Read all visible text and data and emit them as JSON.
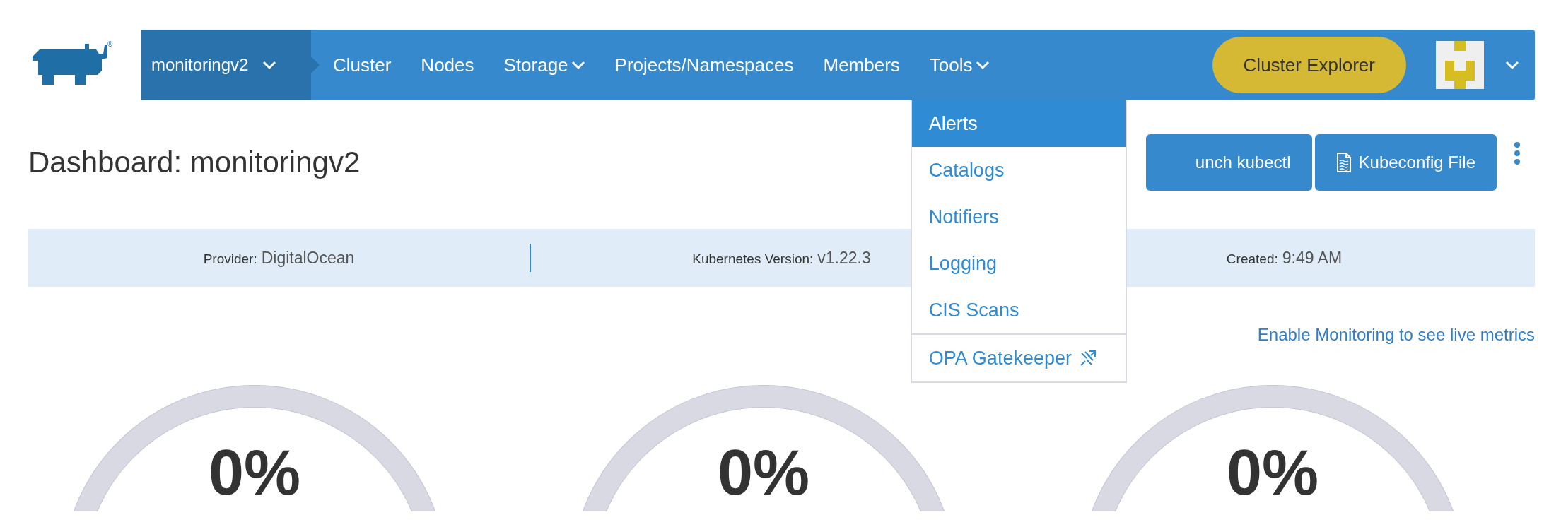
{
  "logo": {
    "mark": "®"
  },
  "nav": {
    "cluster": {
      "label": "monitoringv2"
    },
    "items": [
      {
        "label": "Cluster",
        "has_menu": false
      },
      {
        "label": "Nodes",
        "has_menu": false
      },
      {
        "label": "Storage",
        "has_menu": true
      },
      {
        "label": "Projects/Namespaces",
        "has_menu": false
      },
      {
        "label": "Members",
        "has_menu": false
      },
      {
        "label": "Tools",
        "has_menu": true,
        "expanded": true,
        "menu": [
          {
            "label": "Alerts",
            "selected": true,
            "external": false
          },
          {
            "label": "Catalogs",
            "selected": false,
            "external": false
          },
          {
            "label": "Notifiers",
            "selected": false,
            "external": false
          },
          {
            "label": "Logging",
            "selected": false,
            "external": false
          },
          {
            "label": "CIS Scans",
            "selected": false,
            "external": false
          },
          {
            "label": "OPA Gatekeeper",
            "selected": false,
            "external": true
          }
        ]
      }
    ],
    "explorer_button": "Cluster Explorer"
  },
  "title": "Dashboard: monitoringv2",
  "actions": [
    {
      "label": "unch kubectl",
      "kind": "plain"
    },
    {
      "label": "Kubeconfig File",
      "kind": "document"
    }
  ],
  "info": [
    {
      "label": "Provider:",
      "value": "DigitalOcean"
    },
    {
      "label": "Kubernetes Version:",
      "value": "v1.22.3"
    },
    {
      "label": "Created:",
      "value": "9:49 AM"
    }
  ],
  "monitoring_link": "Enable Monitoring to see live metrics",
  "gauges": [
    {
      "value": "0%",
      "level": 0
    },
    {
      "value": "0%",
      "level": 0
    },
    {
      "value": "0%",
      "level": 0
    }
  ]
}
